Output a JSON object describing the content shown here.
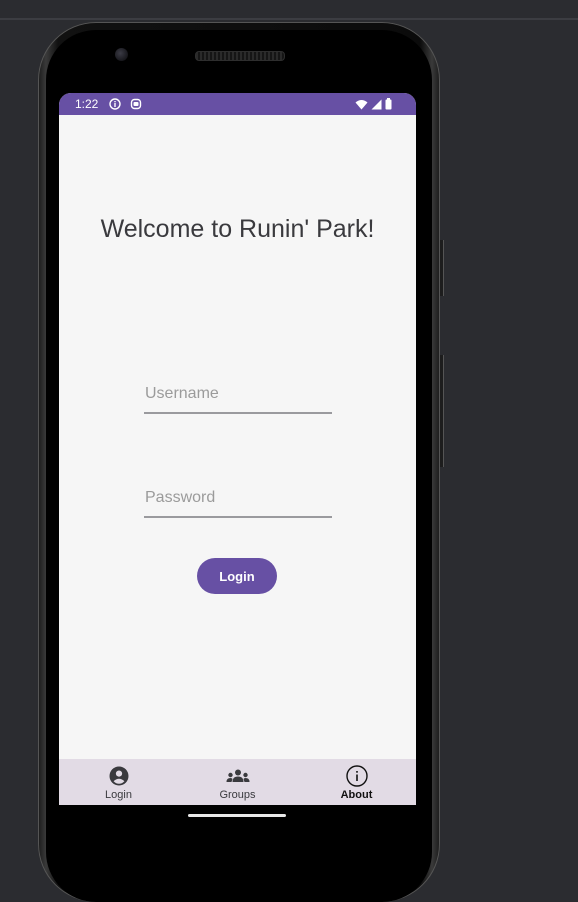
{
  "status_bar": {
    "time": "1:22",
    "color": "#6750a4",
    "left_icons": [
      "info-icon",
      "android-icon"
    ],
    "right_icons": [
      "wifi-icon",
      "signal-icon",
      "battery-icon"
    ]
  },
  "main": {
    "title": "Welcome to Runin' Park!",
    "username": {
      "placeholder": "Username",
      "value": ""
    },
    "password": {
      "placeholder": "Password",
      "value": ""
    },
    "login_button": "Login",
    "accent_color": "#6750a4"
  },
  "bottom_nav": {
    "items": [
      {
        "label": "Login",
        "icon": "account-circle-icon",
        "active": false
      },
      {
        "label": "Groups",
        "icon": "groups-icon",
        "active": false
      },
      {
        "label": "About",
        "icon": "info-outline-icon",
        "active": true
      }
    ]
  }
}
